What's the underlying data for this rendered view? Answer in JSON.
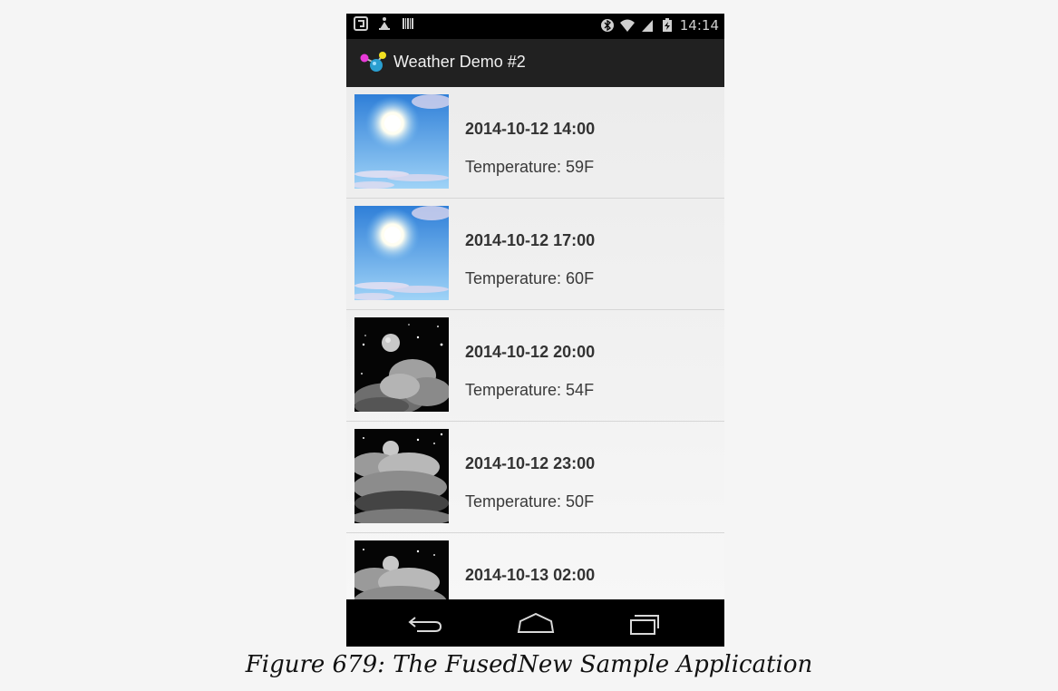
{
  "status_bar": {
    "time": "14:14",
    "left_icons": [
      "usb-debug-icon",
      "android-icon",
      "barcode-icon"
    ],
    "right_icons": [
      "bluetooth-icon",
      "wifi-icon",
      "signal-icon",
      "battery-icon"
    ]
  },
  "action_bar": {
    "title": "Weather Demo #2",
    "icon": "weather-demo-app-icon"
  },
  "forecast": [
    {
      "time": "2014-10-12 14:00",
      "temperature": "Temperature: 59F",
      "icon": "sunny-icon"
    },
    {
      "time": "2014-10-12 17:00",
      "temperature": "Temperature: 60F",
      "icon": "sunny-icon"
    },
    {
      "time": "2014-10-12 20:00",
      "temperature": "Temperature: 54F",
      "icon": "night-cloudy-icon"
    },
    {
      "time": "2014-10-12 23:00",
      "temperature": "Temperature: 50F",
      "icon": "night-overcast-icon"
    },
    {
      "time": "2014-10-13 02:00",
      "temperature": "",
      "icon": "night-overcast-icon"
    }
  ],
  "nav_bar": [
    "back-icon",
    "home-icon",
    "recents-icon"
  ],
  "caption": "Figure 679: The FusedNew Sample Application"
}
